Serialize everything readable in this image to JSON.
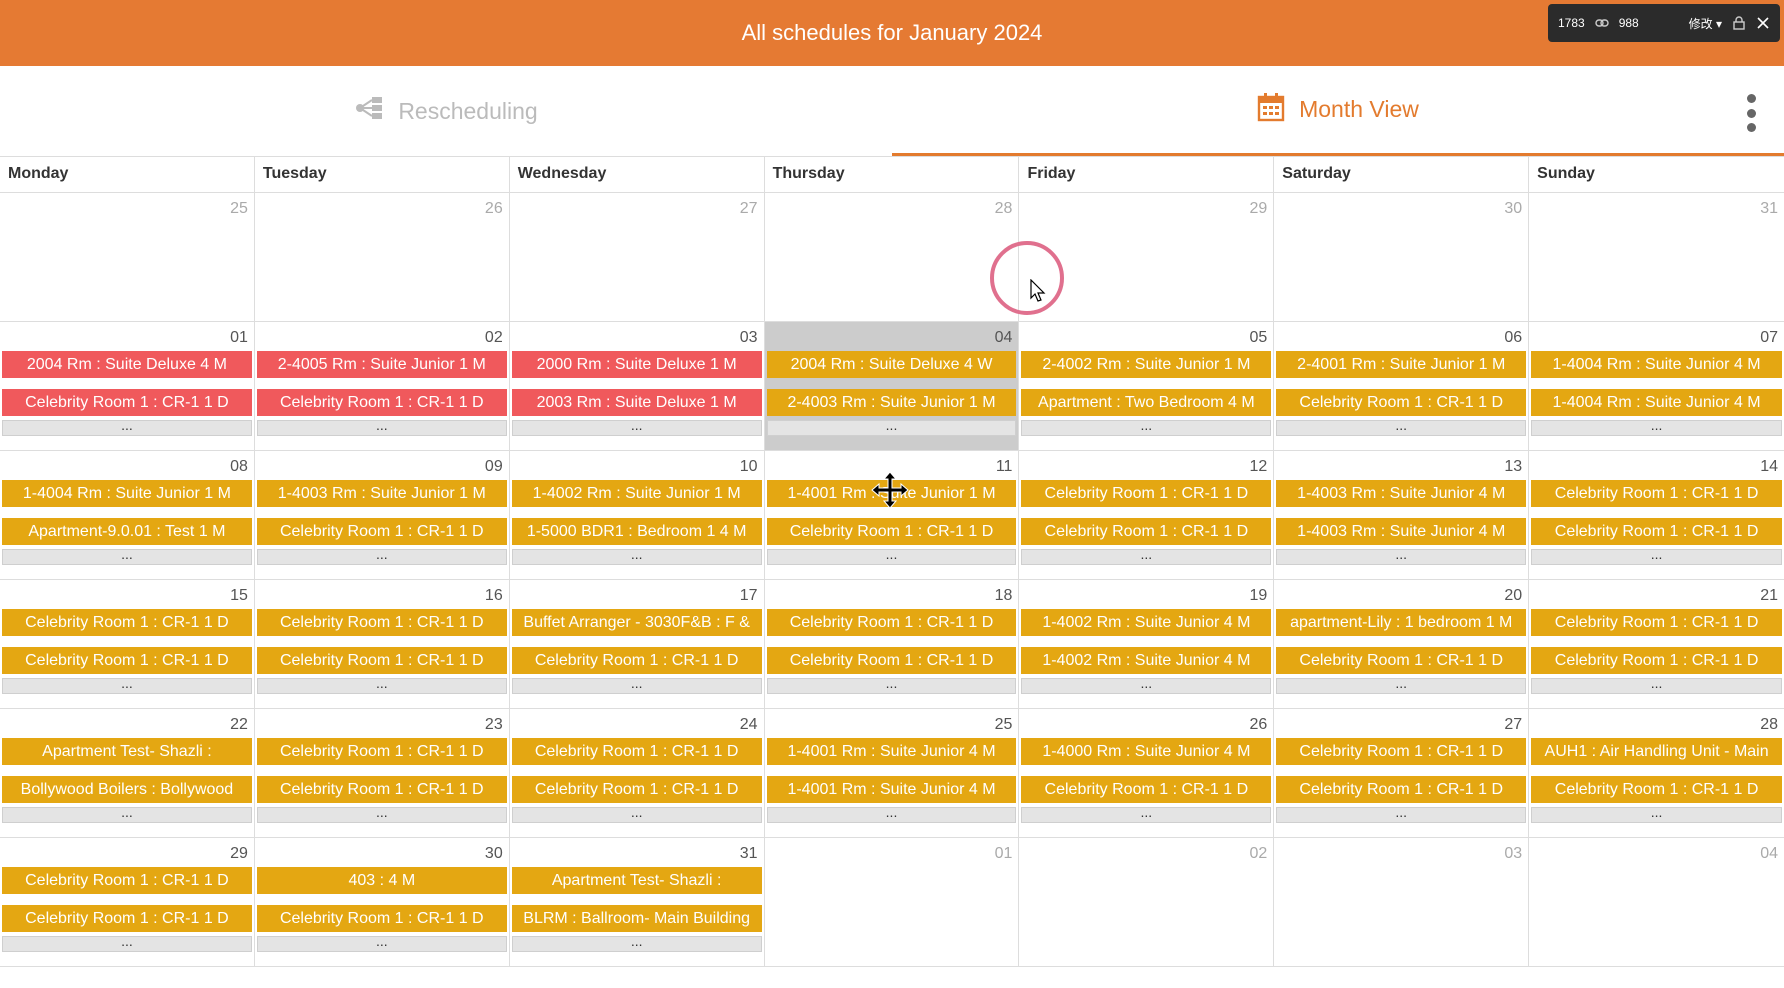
{
  "header": {
    "title": "All schedules for January 2024"
  },
  "overlay": {
    "width_value": "1783",
    "height_value": "988",
    "edit_label": "修改"
  },
  "toolbar": {
    "rescheduling_label": "Rescheduling",
    "month_view_label": "Month View"
  },
  "colors": {
    "accent": "#e57a33",
    "event_red": "#f0595c",
    "event_yellow": "#e4a712"
  },
  "calendar": {
    "weekdays": [
      "Monday",
      "Tuesday",
      "Wednesday",
      "Thursday",
      "Friday",
      "Saturday",
      "Sunday"
    ],
    "more_label": "...",
    "weeks": [
      [
        {
          "day": "25",
          "other": true,
          "events": []
        },
        {
          "day": "26",
          "other": true,
          "events": []
        },
        {
          "day": "27",
          "other": true,
          "events": []
        },
        {
          "day": "28",
          "other": true,
          "events": []
        },
        {
          "day": "29",
          "other": true,
          "events": []
        },
        {
          "day": "30",
          "other": true,
          "events": []
        },
        {
          "day": "31",
          "other": true,
          "events": []
        }
      ],
      [
        {
          "day": "01",
          "events": [
            {
              "t": "2004 Rm : Suite Deluxe 4 M",
              "c": "red"
            },
            {
              "t": "Celebrity Room 1 : CR-1 1 D",
              "c": "red"
            }
          ],
          "more": true
        },
        {
          "day": "02",
          "events": [
            {
              "t": "2-4005 Rm : Suite Junior 1 M",
              "c": "red"
            },
            {
              "t": "Celebrity Room 1 : CR-1 1 D",
              "c": "red"
            }
          ],
          "more": true
        },
        {
          "day": "03",
          "events": [
            {
              "t": "2000 Rm : Suite Deluxe 1 M",
              "c": "red"
            },
            {
              "t": "2003 Rm : Suite Deluxe 1 M",
              "c": "red"
            }
          ],
          "more": true
        },
        {
          "day": "04",
          "highlight": true,
          "events": [
            {
              "t": "2004 Rm : Suite Deluxe 4 W",
              "c": "yel"
            },
            {
              "t": "2-4003 Rm : Suite Junior 1 M",
              "c": "yel"
            }
          ],
          "more": true
        },
        {
          "day": "05",
          "events": [
            {
              "t": "2-4002 Rm : Suite Junior 1 M",
              "c": "yel"
            },
            {
              "t": "Apartment : Two Bedroom 4 M",
              "c": "yel"
            }
          ],
          "more": true
        },
        {
          "day": "06",
          "events": [
            {
              "t": "2-4001 Rm : Suite Junior 1 M",
              "c": "yel"
            },
            {
              "t": "Celebrity Room 1 : CR-1 1 D",
              "c": "yel"
            }
          ],
          "more": true
        },
        {
          "day": "07",
          "events": [
            {
              "t": "1-4004 Rm : Suite Junior 4 M",
              "c": "yel"
            },
            {
              "t": "1-4004 Rm : Suite Junior 4 M",
              "c": "yel"
            }
          ],
          "more": true
        }
      ],
      [
        {
          "day": "08",
          "events": [
            {
              "t": "1-4004 Rm : Suite Junior 1 M",
              "c": "yel"
            },
            {
              "t": "Apartment-9.0.01 : Test 1 M",
              "c": "yel"
            }
          ],
          "more": true
        },
        {
          "day": "09",
          "events": [
            {
              "t": "1-4003 Rm : Suite Junior 1 M",
              "c": "yel"
            },
            {
              "t": "Celebrity Room 1 : CR-1 1 D",
              "c": "yel"
            }
          ],
          "more": true
        },
        {
          "day": "10",
          "events": [
            {
              "t": "1-4002 Rm : Suite Junior 1 M",
              "c": "yel"
            },
            {
              "t": "1-5000 BDR1 : Bedroom 1 4 M",
              "c": "yel"
            }
          ],
          "more": true
        },
        {
          "day": "11",
          "events": [
            {
              "t": "1-4001 Rm : Suite Junior 1 M",
              "c": "yel"
            },
            {
              "t": "Celebrity Room 1 : CR-1 1 D",
              "c": "yel"
            }
          ],
          "more": true
        },
        {
          "day": "12",
          "events": [
            {
              "t": "Celebrity Room 1 : CR-1 1 D",
              "c": "yel"
            },
            {
              "t": "Celebrity Room 1 : CR-1 1 D",
              "c": "yel"
            }
          ],
          "more": true
        },
        {
          "day": "13",
          "events": [
            {
              "t": "1-4003 Rm : Suite Junior 4 M",
              "c": "yel"
            },
            {
              "t": "1-4003 Rm : Suite Junior 4 M",
              "c": "yel"
            }
          ],
          "more": true
        },
        {
          "day": "14",
          "events": [
            {
              "t": "Celebrity Room 1 : CR-1 1 D",
              "c": "yel"
            },
            {
              "t": "Celebrity Room 1 : CR-1 1 D",
              "c": "yel"
            }
          ],
          "more": true
        }
      ],
      [
        {
          "day": "15",
          "events": [
            {
              "t": "Celebrity Room 1 : CR-1 1 D",
              "c": "yel"
            },
            {
              "t": "Celebrity Room 1 : CR-1 1 D",
              "c": "yel"
            }
          ],
          "more": true
        },
        {
          "day": "16",
          "events": [
            {
              "t": "Celebrity Room 1 : CR-1 1 D",
              "c": "yel"
            },
            {
              "t": "Celebrity Room 1 : CR-1 1 D",
              "c": "yel"
            }
          ],
          "more": true
        },
        {
          "day": "17",
          "events": [
            {
              "t": "Buffet Arranger - 3030F&B : F &",
              "c": "yel"
            },
            {
              "t": "Celebrity Room 1 : CR-1 1 D",
              "c": "yel"
            }
          ],
          "more": true
        },
        {
          "day": "18",
          "events": [
            {
              "t": "Celebrity Room 1 : CR-1 1 D",
              "c": "yel"
            },
            {
              "t": "Celebrity Room 1 : CR-1 1 D",
              "c": "yel"
            }
          ],
          "more": true
        },
        {
          "day": "19",
          "events": [
            {
              "t": "1-4002 Rm : Suite Junior 4 M",
              "c": "yel"
            },
            {
              "t": "1-4002 Rm : Suite Junior 4 M",
              "c": "yel"
            }
          ],
          "more": true
        },
        {
          "day": "20",
          "events": [
            {
              "t": "apartment-Lily : 1 bedroom 1 M",
              "c": "yel"
            },
            {
              "t": "Celebrity Room 1 : CR-1 1 D",
              "c": "yel"
            }
          ],
          "more": true
        },
        {
          "day": "21",
          "events": [
            {
              "t": "Celebrity Room 1 : CR-1 1 D",
              "c": "yel"
            },
            {
              "t": "Celebrity Room 1 : CR-1 1 D",
              "c": "yel"
            }
          ],
          "more": true
        }
      ],
      [
        {
          "day": "22",
          "events": [
            {
              "t": "Apartment Test- Shazli :",
              "c": "yel"
            },
            {
              "t": "Bollywood Boilers : Bollywood",
              "c": "yel"
            }
          ],
          "more": true
        },
        {
          "day": "23",
          "events": [
            {
              "t": "Celebrity Room 1 : CR-1 1 D",
              "c": "yel"
            },
            {
              "t": "Celebrity Room 1 : CR-1 1 D",
              "c": "yel"
            }
          ],
          "more": true
        },
        {
          "day": "24",
          "events": [
            {
              "t": "Celebrity Room 1 : CR-1 1 D",
              "c": "yel"
            },
            {
              "t": "Celebrity Room 1 : CR-1 1 D",
              "c": "yel"
            }
          ],
          "more": true
        },
        {
          "day": "25",
          "events": [
            {
              "t": "1-4001 Rm : Suite Junior 4 M",
              "c": "yel"
            },
            {
              "t": "1-4001 Rm : Suite Junior 4 M",
              "c": "yel"
            }
          ],
          "more": true
        },
        {
          "day": "26",
          "events": [
            {
              "t": "1-4000 Rm : Suite Junior 4 M",
              "c": "yel"
            },
            {
              "t": "Celebrity Room 1 : CR-1 1 D",
              "c": "yel"
            }
          ],
          "more": true
        },
        {
          "day": "27",
          "events": [
            {
              "t": "Celebrity Room 1 : CR-1 1 D",
              "c": "yel"
            },
            {
              "t": "Celebrity Room 1 : CR-1 1 D",
              "c": "yel"
            }
          ],
          "more": true
        },
        {
          "day": "28",
          "events": [
            {
              "t": "AUH1 : Air Handling Unit - Main",
              "c": "yel"
            },
            {
              "t": "Celebrity Room 1 : CR-1 1 D",
              "c": "yel"
            }
          ],
          "more": true
        }
      ],
      [
        {
          "day": "29",
          "events": [
            {
              "t": "Celebrity Room 1 : CR-1 1 D",
              "c": "yel"
            },
            {
              "t": "Celebrity Room 1 : CR-1 1 D",
              "c": "yel"
            }
          ],
          "more": true
        },
        {
          "day": "30",
          "events": [
            {
              "t": "403 : 4 M",
              "c": "yel"
            },
            {
              "t": "Celebrity Room 1 : CR-1 1 D",
              "c": "yel"
            }
          ],
          "more": true
        },
        {
          "day": "31",
          "events": [
            {
              "t": "Apartment Test- Shazli :",
              "c": "yel"
            },
            {
              "t": "BLRM : Ballroom- Main Building",
              "c": "yel"
            }
          ],
          "more": true
        },
        {
          "day": "01",
          "other": true,
          "events": []
        },
        {
          "day": "02",
          "other": true,
          "events": []
        },
        {
          "day": "03",
          "other": true,
          "events": []
        },
        {
          "day": "04",
          "other": true,
          "events": []
        }
      ]
    ]
  }
}
